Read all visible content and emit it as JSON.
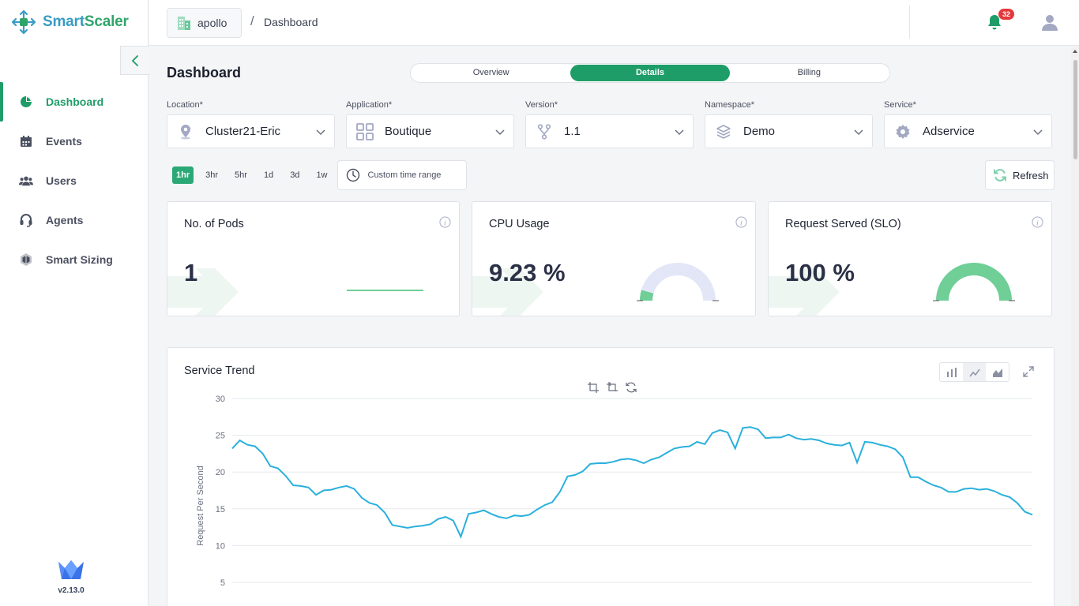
{
  "brand": {
    "name_part1": "Smart",
    "name_part2": "Scaler",
    "version": "v2.13.0",
    "accent": "#1e9d68"
  },
  "sidebar": {
    "items": [
      {
        "label": "Dashboard",
        "icon": "pie-chart-icon",
        "active": true
      },
      {
        "label": "Events",
        "icon": "calendar-icon",
        "active": false
      },
      {
        "label": "Users",
        "icon": "users-icon",
        "active": false
      },
      {
        "label": "Agents",
        "icon": "headset-icon",
        "active": false
      },
      {
        "label": "Smart Sizing",
        "icon": "cube-icon",
        "active": false
      }
    ]
  },
  "header": {
    "tenant": "apollo",
    "separator": "/",
    "breadcrumb": "Dashboard",
    "notifications_count": "32"
  },
  "page": {
    "title": "Dashboard",
    "tabs": [
      {
        "label": "Overview",
        "active": false
      },
      {
        "label": "Details",
        "active": true
      },
      {
        "label": "Billing",
        "active": false
      }
    ]
  },
  "filters": [
    {
      "label": "Location*",
      "value": "Cluster21-Eric",
      "icon": "location-icon"
    },
    {
      "label": "Application*",
      "value": "Boutique",
      "icon": "grid-icon"
    },
    {
      "label": "Version*",
      "value": "1.1",
      "icon": "branch-icon"
    },
    {
      "label": "Namespace*",
      "value": "Demo",
      "icon": "layers-icon"
    },
    {
      "label": "Service*",
      "value": "Adservice",
      "icon": "gear-icon"
    }
  ],
  "time_ranges": {
    "options": [
      "1hr",
      "3hr",
      "5hr",
      "1d",
      "3d",
      "1w"
    ],
    "selected": "1hr",
    "custom_label": "Custom time range"
  },
  "refresh_label": "Refresh",
  "cards": [
    {
      "title": "No. of Pods",
      "value": "1"
    },
    {
      "title": "CPU Usage",
      "value": "9.23 %",
      "gauge_fraction": 0.092,
      "gauge_color": "#6fcf97"
    },
    {
      "title": "Request Served (SLO)",
      "value": "100 %",
      "gauge_fraction": 1.0,
      "gauge_color": "#6fcf97"
    }
  ],
  "trend": {
    "title": "Service Trend",
    "chart_data": {
      "type": "line",
      "ylabel": "Request Per Second",
      "ylim": [
        0,
        30
      ],
      "yticks": [
        5,
        10,
        15,
        20,
        25,
        30
      ],
      "color": "#2ab0dc",
      "values": [
        23.2,
        24.3,
        23.7,
        23.5,
        22.5,
        20.8,
        20.5,
        19.5,
        18.2,
        18.1,
        17.9,
        16.9,
        17.5,
        17.6,
        17.9,
        18.1,
        17.7,
        16.5,
        15.8,
        15.5,
        14.5,
        12.8,
        12.6,
        12.4,
        12.6,
        12.7,
        12.9,
        13.6,
        13.9,
        13.4,
        11.2,
        14.3,
        14.5,
        14.8,
        14.3,
        13.9,
        13.7,
        14.1,
        14.0,
        14.2,
        14.9,
        15.5,
        15.9,
        17.3,
        19.4,
        19.6,
        20.1,
        21.1,
        21.2,
        21.2,
        21.4,
        21.7,
        21.8,
        21.6,
        21.2,
        21.7,
        22.0,
        22.6,
        23.2,
        23.4,
        23.5,
        24.1,
        23.8,
        25.3,
        25.7,
        25.4,
        23.2,
        26.0,
        26.1,
        25.8,
        24.6,
        24.7,
        24.7,
        25.1,
        24.6,
        24.4,
        24.5,
        24.3,
        23.9,
        23.7,
        23.6,
        24.0,
        21.3,
        24.1,
        24.0,
        23.7,
        23.5,
        23.1,
        22.0,
        19.3,
        19.3,
        18.7,
        18.2,
        17.9,
        17.3,
        17.3,
        17.7,
        17.8,
        17.6,
        17.7,
        17.4,
        16.9,
        16.6,
        15.8,
        14.6,
        14.2
      ]
    }
  }
}
